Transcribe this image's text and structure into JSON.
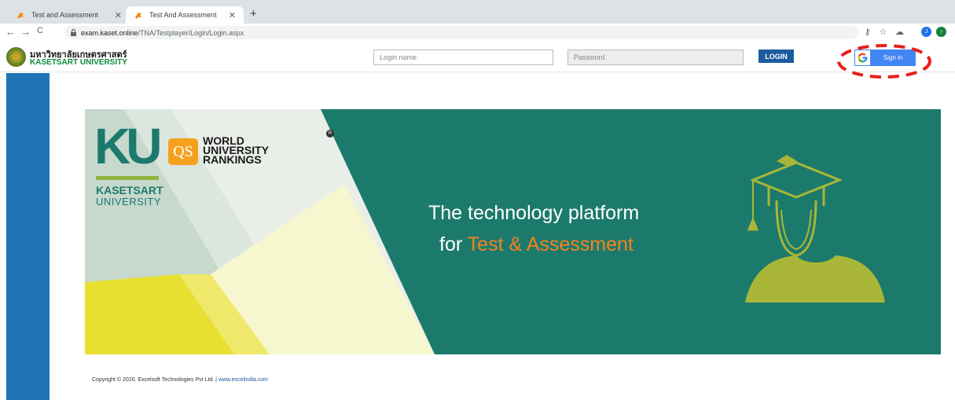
{
  "browser": {
    "tabs": [
      {
        "label": "Test and Assessment",
        "active": false
      },
      {
        "label": "Test And Assessment",
        "active": true
      }
    ],
    "new_tab": "+",
    "nav": {
      "back": "←",
      "forward": "→",
      "reload": "C"
    },
    "url_host": "exam.kaset.online",
    "url_path": "/TNA/Testplayer/Login/Login.aspx",
    "extensions": [
      {
        "icon": "key-icon",
        "color": "#5f6368"
      },
      {
        "icon": "star-icon",
        "color": "#5f6368"
      },
      {
        "icon": "cloud-icon",
        "color": "#5f6368"
      },
      {
        "icon": "profile-icon",
        "color": "#1a73e8",
        "text": "J"
      },
      {
        "icon": "update-icon",
        "color": "#188038"
      }
    ]
  },
  "header": {
    "university_thai": "มหาวิทยาลัยเกษตรศาสตร์",
    "university_en": "KASETSART UNIVERSITY",
    "login_placeholder": "Login name",
    "password_placeholder": "Password",
    "login_button": "LOGIN",
    "google_sign_in": "Sign in",
    "google_g": "G"
  },
  "banner": {
    "ku_letters": "KU",
    "ku_name_line1": "KASETSART",
    "ku_name_line2": "UNIVERSITY",
    "qs_letters": "QS",
    "rankings_line1": "WORLD",
    "rankings_line2": "UNIVERSITY",
    "rankings_line3": "RANKINGS",
    "registered": "R",
    "headline_line1": "The technology platform",
    "headline_line2_prefix": "for ",
    "headline_line2_highlight": "Test & Assessment"
  },
  "footer": {
    "copyright": "Copyright © 2020. Excelsoft Technologies Pvt Ltd. | ",
    "link": "www.excelindia.com"
  },
  "colors": {
    "sidebar": "#1f74b5",
    "banner": "#1c7a6c",
    "highlight": "#f5821f",
    "annotation": "#e8201a",
    "google_blue": "#4285f4"
  }
}
